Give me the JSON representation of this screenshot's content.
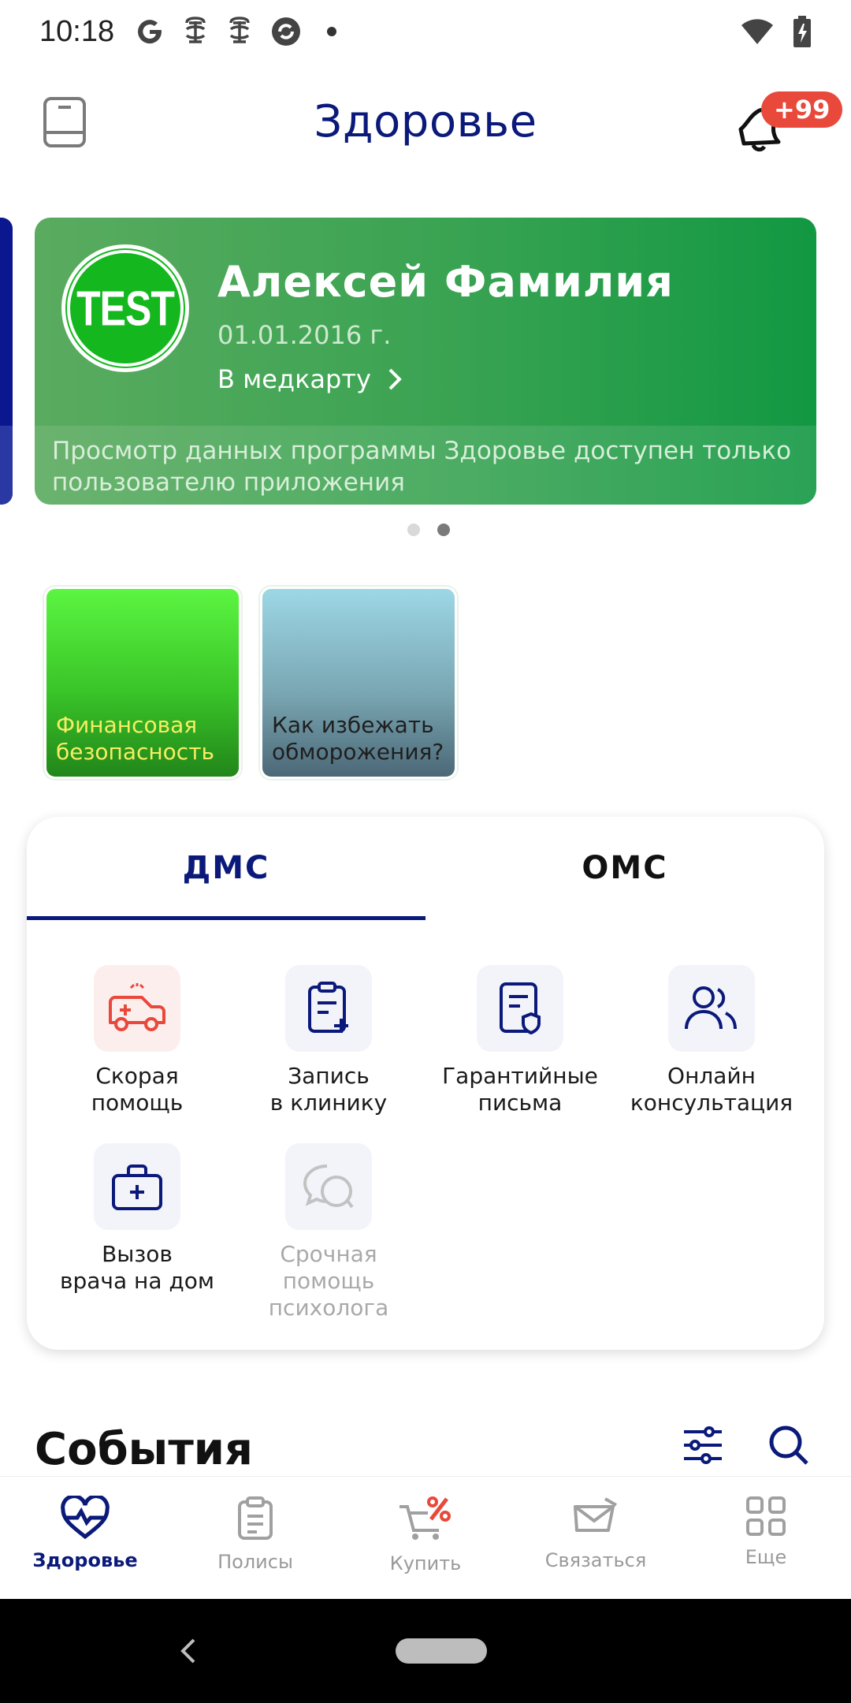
{
  "status_bar": {
    "time": "10:18",
    "icons": [
      "google-icon",
      "notification-icon",
      "notification-icon",
      "sync-icon",
      "more-dot-icon",
      "wifi-icon",
      "battery-charging-icon"
    ]
  },
  "header": {
    "title": "Здоровье",
    "badge": "+99"
  },
  "profile_card": {
    "badge_text": "TEST",
    "name": "Алексей Фамилия",
    "dob": "01.01.2016 г.",
    "link_label": "В медкарту",
    "notice": "Просмотр данных программы Здоровье доступен только пользователю приложения"
  },
  "carousel": {
    "pages": 2,
    "active_page": 2
  },
  "stories": [
    {
      "label": "Финансовая безопасность"
    },
    {
      "label": "Как избежать обморожения?"
    }
  ],
  "tabs": [
    {
      "label": "ДМС",
      "active": true
    },
    {
      "label": "ОМС",
      "active": false
    }
  ],
  "services": [
    {
      "label_line1": "Скорая",
      "label_line2": "помощь",
      "label_line3": ""
    },
    {
      "label_line1": "Запись",
      "label_line2": "в клинику",
      "label_line3": ""
    },
    {
      "label_line1": "Гарантийные",
      "label_line2": "письма",
      "label_line3": ""
    },
    {
      "label_line1": "Онлайн",
      "label_line2": "консультация",
      "label_line3": ""
    },
    {
      "label_line1": "Вызов",
      "label_line2": "врача на дом",
      "label_line3": ""
    },
    {
      "label_line1": "Срочная",
      "label_line2": "помощь",
      "label_line3": "психолога"
    }
  ],
  "events": {
    "title": "События"
  },
  "bottom_nav": [
    {
      "label": "Здоровье",
      "active": true
    },
    {
      "label": "Полисы",
      "active": false
    },
    {
      "label": "Купить",
      "active": false
    },
    {
      "label": "Связаться",
      "active": false
    },
    {
      "label": "Еще",
      "active": false
    }
  ],
  "colors": {
    "brand_navy": "#0b1a7a",
    "card_green": "#38a352",
    "badge_red": "#e8493b",
    "ambulance_red": "#e8493b"
  }
}
